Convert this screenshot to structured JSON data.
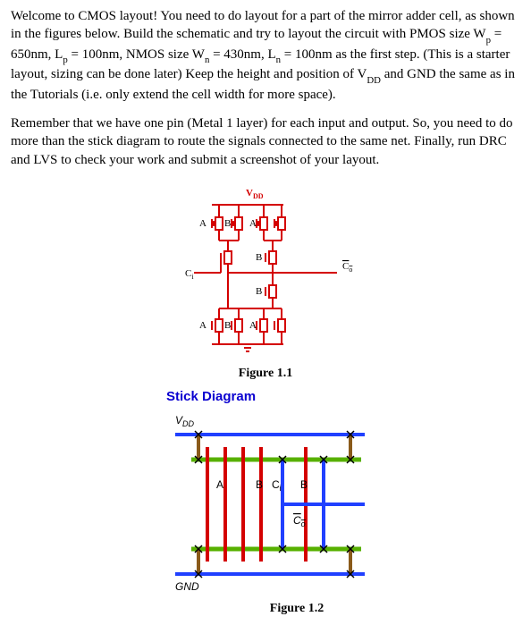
{
  "para1": {
    "t1": "Welcome to CMOS layout! You need to do layout for a part of the mirror adder cell, as shown in the figures below. Build the schematic and try to layout the circuit with PMOS size W",
    "sub_p1": "p",
    "t2": " = 650nm, L",
    "sub_p2": "p",
    "t3": " = 100nm, NMOS size W",
    "sub_n1": "n",
    "t4": " = 430nm, L",
    "sub_n2": "n",
    "t5": " = 100nm as the first step. (This is a starter layout, sizing can be done later) Keep the height and position of V",
    "sub_dd": "DD",
    "t6": " and GND the same as in the Tutorials (i.e. only extend the cell width for more space)."
  },
  "para2": "Remember that we have one pin (Metal 1 layer) for each input and output. So, you need to do more than the stick diagram to route the signals connected to the same net. Finally, run DRC and LVS to check your work and submit a screenshot of your layout.",
  "fig1": {
    "vdd": "V",
    "vdd_sub": "DD",
    "A": "A",
    "B": "B",
    "Ci": "C",
    "Ci_sub": "i",
    "Co_bar": "C",
    "Co_sub": "o",
    "caption": "Figure 1.1"
  },
  "stick_title": "Stick Diagram",
  "fig2": {
    "vdd": "V",
    "vdd_sub": "DD",
    "gnd": "GND",
    "A": "A",
    "B": "B",
    "Ci": "C",
    "Ci_sub": "i",
    "Co_bar": "C",
    "Co_sub": "o",
    "caption": "Figure 1.2"
  }
}
